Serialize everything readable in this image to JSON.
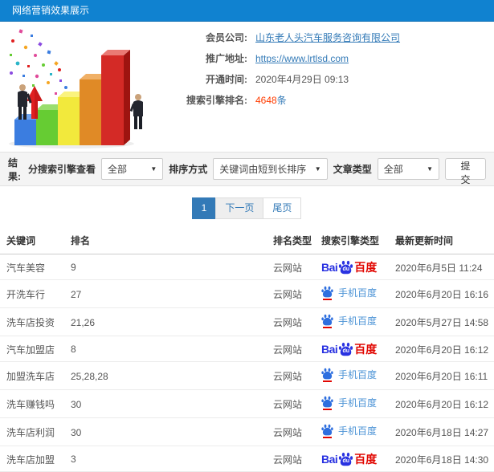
{
  "header": {
    "title": "网络营销效果展示"
  },
  "info": {
    "member_company_label": "会员公司:",
    "member_company_value": "山东老人头汽车服务咨询有限公司",
    "promo_url_label": "推广地址:",
    "promo_url_value": "https://www.lrtlsd.com",
    "open_time_label": "开通时间:",
    "open_time_value": "2020年4月29日 09:13",
    "engine_rank_label": "搜索引擎排名:",
    "engine_rank_count": "4648",
    "engine_rank_unit": "条"
  },
  "filters": {
    "result_label": "结果:",
    "engine_view_label": "分搜索引擎查看",
    "engine_view_value": "全部",
    "sort_label": "排序方式",
    "sort_value": "关键词由短到长排序",
    "article_type_label": "文章类型",
    "article_type_value": "全部",
    "submit_label": "提交"
  },
  "pagination": {
    "current_page": "1",
    "next_label": "下一页",
    "last_label": "尾页"
  },
  "table": {
    "headers": [
      "关键词",
      "排名",
      "排名类型",
      "搜索引擎类型",
      "最新更新时间"
    ],
    "engines": {
      "baidu": {
        "prefix": "Bai",
        "du": "du",
        "suffix": "百度"
      },
      "mobile_baidu": {
        "label": "手机百度"
      }
    },
    "rows": [
      {
        "keyword": "汽车美容",
        "rank": "9",
        "rank_type": "云网站",
        "engine": "baidu",
        "updated": "2020年6月5日 11:24"
      },
      {
        "keyword": "开洗车行",
        "rank": "27",
        "rank_type": "云网站",
        "engine": "mobile_baidu",
        "updated": "2020年6月20日 16:16"
      },
      {
        "keyword": "洗车店投资",
        "rank": "21,26",
        "rank_type": "云网站",
        "engine": "mobile_baidu",
        "updated": "2020年5月27日 14:58"
      },
      {
        "keyword": "汽车加盟店",
        "rank": "8",
        "rank_type": "云网站",
        "engine": "baidu",
        "updated": "2020年6月20日 16:12"
      },
      {
        "keyword": "加盟洗车店",
        "rank": "25,28,28",
        "rank_type": "云网站",
        "engine": "mobile_baidu",
        "updated": "2020年6月20日 16:11"
      },
      {
        "keyword": "洗车赚钱吗",
        "rank": "30",
        "rank_type": "云网站",
        "engine": "mobile_baidu",
        "updated": "2020年6月20日 16:12"
      },
      {
        "keyword": "洗车店利润",
        "rank": "30",
        "rank_type": "云网站",
        "engine": "mobile_baidu",
        "updated": "2020年6月18日 14:27"
      },
      {
        "keyword": "洗车店加盟",
        "rank": "3",
        "rank_type": "云网站",
        "engine": "baidu",
        "updated": "2020年6月18日 14:30"
      }
    ]
  },
  "colors": {
    "header_blue": "#1082d0",
    "link_blue": "#337ab7",
    "rank_count_red": "#ff3c00",
    "baidu_blue": "#2932e1",
    "baidu_red": "#e10601",
    "filter_bar_bg": "#f4f4f4"
  }
}
